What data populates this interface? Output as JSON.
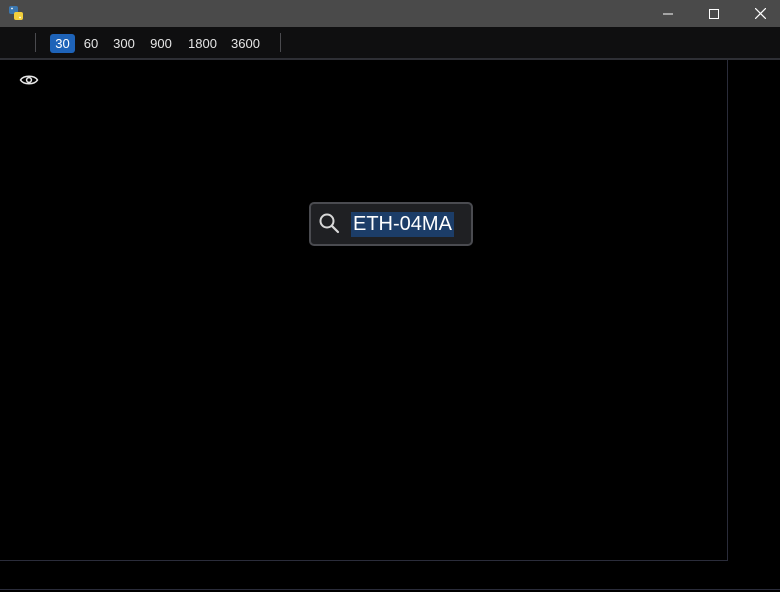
{
  "window": {
    "app_icon": "python-icon",
    "controls": {
      "minimize_icon": "minimize-icon",
      "maximize_icon": "maximize-icon",
      "close_icon": "close-icon"
    }
  },
  "toolbar": {
    "timeframes": [
      "30",
      "60",
      "300",
      "900",
      "1800",
      "3600"
    ],
    "active_timeframe": "30"
  },
  "chart": {
    "visibility_icon": "eye-icon"
  },
  "search": {
    "icon": "search-icon",
    "value": "ETH-04MA",
    "selected": true,
    "selection_color": "#1c3d68"
  },
  "colors": {
    "titlebar": "#4a4a4a",
    "toolbar": "#0f0f10",
    "active_timeframe": "#1e63b8",
    "background": "#000000"
  }
}
